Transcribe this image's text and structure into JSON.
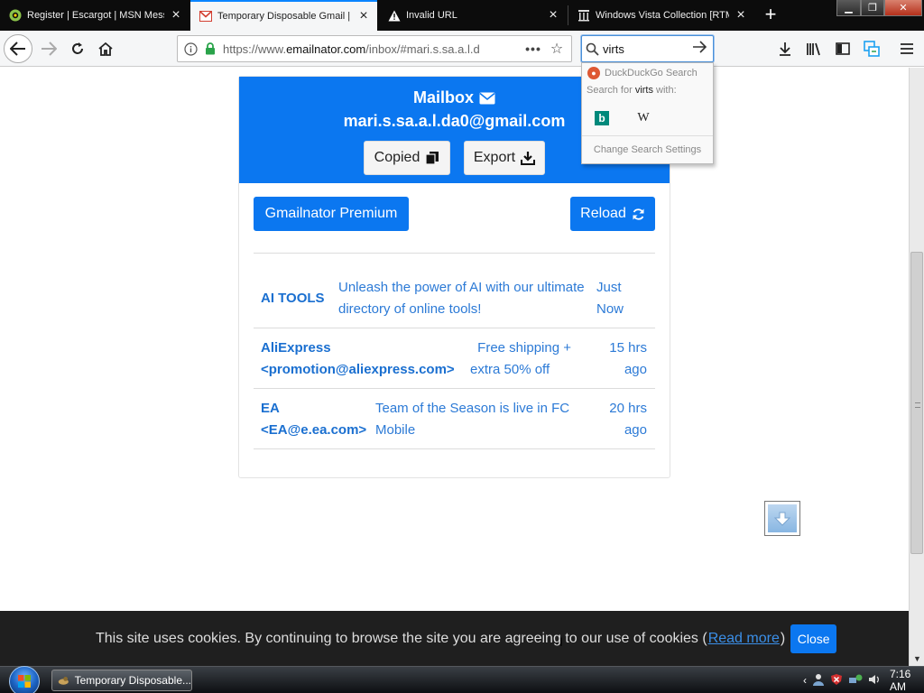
{
  "browser": {
    "tabs": [
      {
        "title": "Register | Escargot | MSN Mess",
        "active": false
      },
      {
        "title": "Temporary Disposable Gmail | T",
        "active": true
      },
      {
        "title": "Invalid URL",
        "active": false
      },
      {
        "title": "Windows Vista Collection [RTM",
        "active": false
      }
    ],
    "url_prefix": "https://www.",
    "url_host": "emailnator.com",
    "url_path": "/inbox/#mari.s.sa.a.l.d",
    "search_value": "virts"
  },
  "search_dropdown": {
    "engine_name": "DuckDuckGo Search",
    "search_for_prefix": "Search for",
    "search_for_query": "virts",
    "search_for_suffix": "with:",
    "change_settings": "Change Search Settings"
  },
  "mailbox": {
    "title": "Mailbox",
    "address": "mari.s.sa.a.l.da0@gmail.com",
    "copied_label": "Copied",
    "export_label": "Export",
    "premium_label": "Gmailnator Premium",
    "reload_label": "Reload",
    "brand_color": "#0b77f0"
  },
  "messages": [
    {
      "sender_line1": "AI TOOLS",
      "sender_line2": "",
      "subject_line1": "Unleash the power of AI with our ultimate",
      "subject_line2": "directory of online tools!",
      "time_line1": "Just",
      "time_line2": "Now"
    },
    {
      "sender_line1": "AliExpress",
      "sender_line2": "<promotion@aliexpress.com>",
      "subject_line1": "Free shipping +",
      "subject_line2": "extra 50% off",
      "time_line1": "15 hrs",
      "time_line2": "ago"
    },
    {
      "sender_line1": "EA",
      "sender_line2": "<EA@e.ea.com>",
      "subject_line1": "Team of the Season is live in FC",
      "subject_line2": "Mobile",
      "time_line1": "20 hrs",
      "time_line2": "ago"
    }
  ],
  "cookie_banner": {
    "text": "This site uses cookies. By continuing to browse the site you are agreeing to our use of cookies (",
    "read_more": "Read more",
    "close_paren": ")",
    "close_label": "Close"
  },
  "taskbar": {
    "task_label": "Temporary Disposable...",
    "clock": "7:16 AM"
  }
}
